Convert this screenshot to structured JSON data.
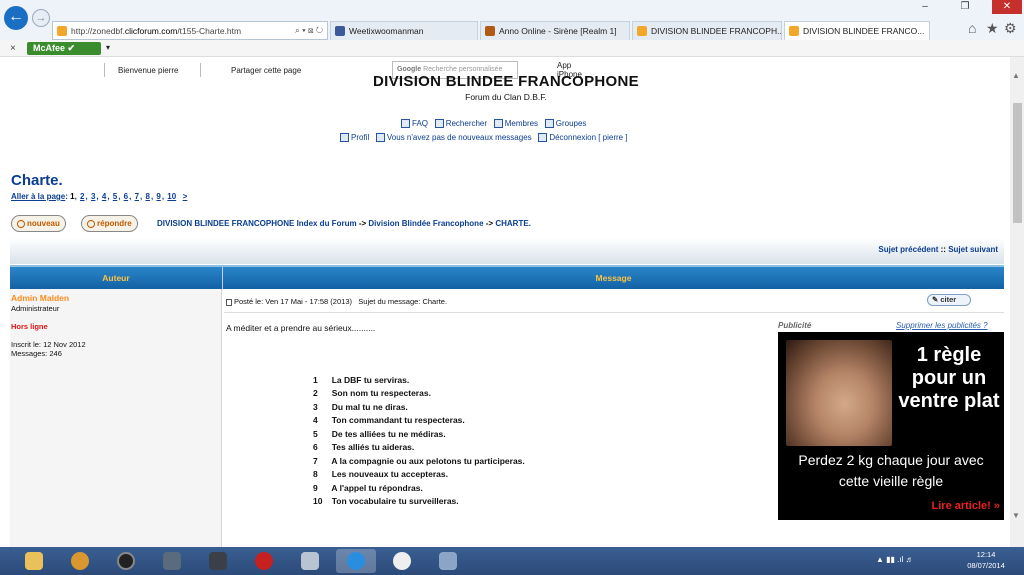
{
  "browser": {
    "url_prefix": "http://zonedbf.",
    "url_domain": "clicforum.com",
    "url_path": "/t155-Charte.htm",
    "tabs": [
      {
        "label": "Weetixwoomanman",
        "close": ""
      },
      {
        "label": "Anno Online - Sirène [Realm 1]",
        "close": ""
      },
      {
        "label": "DIVISION BLINDEE FRANCOPH...",
        "close": ""
      },
      {
        "label": "DIVISION BLINDEE FRANCO...",
        "close": "×"
      }
    ],
    "search_suffix": "⌕ ▾ ⊠ ↻",
    "security_label": "McAfee",
    "close_x": "×"
  },
  "site_bar": {
    "welcome": "Bienvenue pierre",
    "share": "Partager cette page",
    "google": "Google",
    "google_placeholder": "Recherche personnalisée",
    "app": "App iPhone"
  },
  "header": {
    "title": "DIVISION BLINDEE FRANCOPHONE",
    "subtitle": "Forum du Clan D.B.F."
  },
  "menu": {
    "row1": [
      "FAQ",
      "Rechercher",
      "Membres",
      "Groupes"
    ],
    "row2": [
      "Profil",
      "Vous n'avez pas de nouveaux messages",
      "Déconnexion [ pierre ]"
    ]
  },
  "topic": {
    "title": "Charte.",
    "goto_label": "Aller à la page",
    "current_page": "1",
    "pages": [
      "2",
      "3",
      "4",
      "5",
      "6",
      "7",
      "8",
      "9",
      "10"
    ],
    "next": ">"
  },
  "actions": {
    "new": "nouveau",
    "reply": "répondre"
  },
  "breadcrumbs": {
    "index": "DIVISION BLINDEE FRANCOPHONE Index du Forum",
    "forum": "Division Blindée Francophone",
    "topic": "CHARTE.",
    "sep": "->"
  },
  "nav": {
    "prev": "Sujet précédent",
    "sep": "::",
    "next": "Sujet suivant"
  },
  "table": {
    "col_author": "Auteur",
    "col_message": "Message"
  },
  "post": {
    "author": "Admin Malden",
    "role": "Administrateur",
    "status": "Hors ligne",
    "joined": "Inscrit le: 12 Nov 2012",
    "messages": "Messages: 246",
    "posted": "Posté le: Ven 17 Mai - 17:58 (2013)",
    "subject": "Sujet du message: Charte.",
    "quote": "citer",
    "intro": "A méditer et a prendre au sérieux..........",
    "rules": [
      {
        "n": "1",
        "text": "La DBF tu serviras."
      },
      {
        "n": "2",
        "text": "Son nom tu respecteras."
      },
      {
        "n": "3",
        "text": "Du mal tu ne diras."
      },
      {
        "n": "4",
        "text": "Ton commandant tu respecteras."
      },
      {
        "n": "5",
        "text": "De tes alliées tu ne médiras."
      },
      {
        "n": "6",
        "text": "Tes alliés tu aideras."
      },
      {
        "n": "7",
        "text": "A la compagnie ou aux pelotons tu participeras."
      },
      {
        "n": "8",
        "text": "Les nouveaux tu accepteras."
      },
      {
        "n": "9",
        "text": "A l'appel tu répondras."
      },
      {
        "n": "10",
        "text": "Ton vocabulaire tu surveilleras."
      }
    ]
  },
  "ad": {
    "label": "Publicité",
    "remove": "Supprimer les publicités ?",
    "title": "1 règle pour un ventre plat",
    "subtitle": "Perdez 2 kg chaque jour avec cette vieille règle",
    "cta": "Lire article! »"
  },
  "clock": {
    "time": "12:14",
    "date": "08/07/2014"
  },
  "colors": {
    "link": "#0b3d91",
    "header_bar": "#1261a5",
    "author": "#ff8a1a",
    "offline": "#e01212"
  }
}
